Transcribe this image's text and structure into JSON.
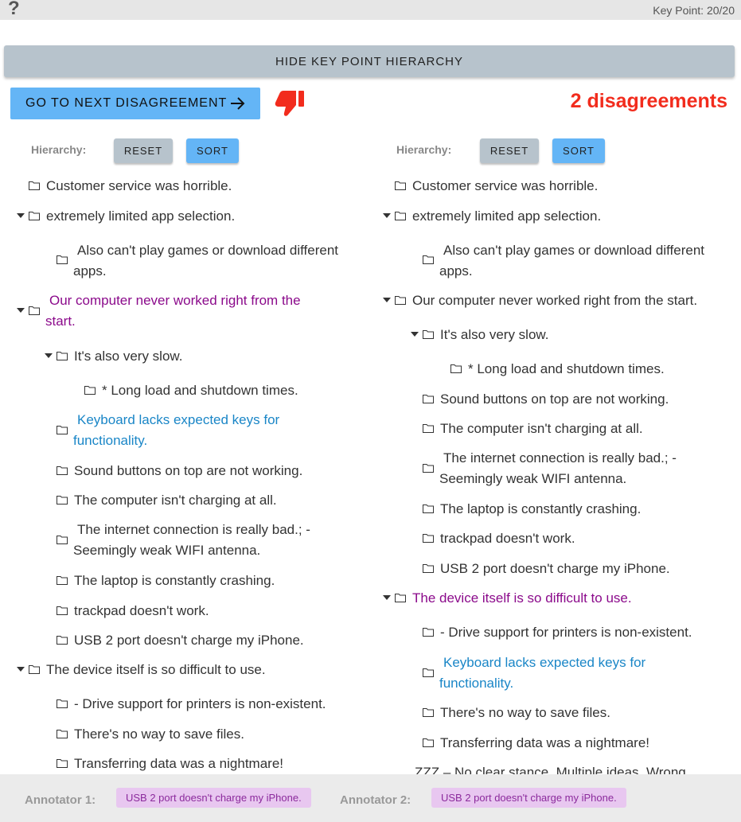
{
  "header": {
    "help": "?",
    "key_point_counter": "Key Point: 20/20"
  },
  "toolbar": {
    "hide_hierarchy": "HIDE KEY POINT HIERARCHY",
    "next_disagreement": "GO TO NEXT DISAGREEMENT",
    "disagreement_count": "2 disagreements"
  },
  "left_panel": {
    "hierarchy_label": "Hierarchy:",
    "reset": "RESET",
    "sort": "SORT",
    "nodes": [
      "Customer service was horrible.",
      "extremely limited app selection.",
      "Also can't play games or download different apps.",
      "Our computer never worked right from the start.",
      "It's also very slow.",
      "* Long load and shutdown times.",
      "Keyboard lacks expected keys for functionality.",
      "Sound buttons on top are not working.",
      "The computer isn't charging at all.",
      "The internet connection is really bad.; - Seemingly weak WIFI antenna.",
      "The laptop is constantly crashing.",
      "trackpad doesn't work.",
      "USB 2 port doesn't charge my iPhone.",
      "The device itself is so difficult to use.",
      "- Drive support for printers is non-existent.",
      "There's no way to save files.",
      "Transferring data was a nightmare!"
    ]
  },
  "right_panel": {
    "hierarchy_label": "Hierarchy:",
    "reset": "RESET",
    "sort": "SORT",
    "nodes": [
      "Customer service was horrible.",
      "extremely limited app selection.",
      "Also can't play games or download different apps.",
      "Our computer never worked right from the start.",
      "It's also very slow.",
      "* Long load and shutdown times.",
      "Sound buttons on top are not working.",
      "The computer isn't charging at all.",
      "The internet connection is really bad.; - Seemingly weak WIFI antenna.",
      "The laptop is constantly crashing.",
      "trackpad doesn't work.",
      "USB 2 port doesn't charge my iPhone.",
      "The device itself is so difficult to use.",
      "- Drive support for printers is non-existent.",
      "Keyboard lacks expected keys for functionality.",
      "There's no way to save files.",
      "Transferring data was a nightmare!",
      "ZZZ – No clear stance. Multiple ideas. Wrong"
    ]
  },
  "footer": {
    "annotator1_label": "Annotator 1:",
    "annotator1_value": "USB 2 port doesn't charge my iPhone.",
    "annotator2_label": "Annotator 2:",
    "annotator2_value": "USB 2 port doesn't charge my iPhone."
  },
  "colors": {
    "primary_button": "#64b5f6",
    "secondary_button": "#b7c3cc",
    "disagreement_red": "#f22c1d",
    "highlight_purple": "#8b0a8b",
    "highlight_blue": "#1a86c7",
    "chip_bg": "#e8c7f0"
  }
}
